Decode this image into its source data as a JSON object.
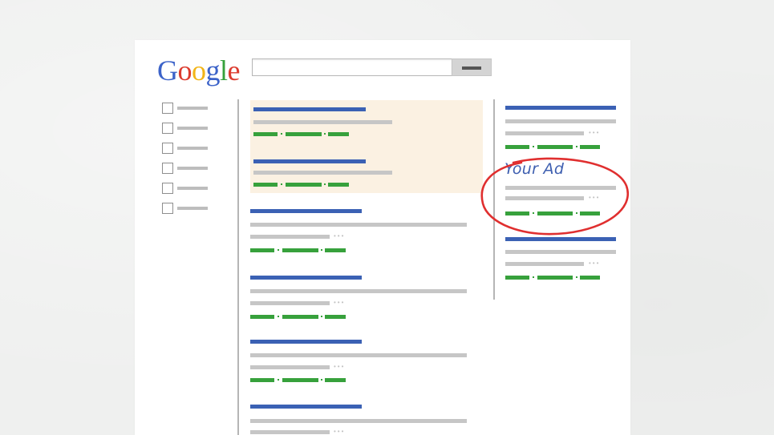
{
  "logo": {
    "letters": [
      {
        "char": "G",
        "color": "#3c63c9"
      },
      {
        "char": "o",
        "color": "#dc3b2e"
      },
      {
        "char": "o",
        "color": "#f2b518"
      },
      {
        "char": "g",
        "color": "#3c63c9"
      },
      {
        "char": "l",
        "color": "#37a13c"
      },
      {
        "char": "e",
        "color": "#dc3b2e"
      }
    ]
  },
  "search": {
    "value": "",
    "button_icon": "search-button-bar-icon"
  },
  "filters": {
    "count": 6
  },
  "annotation": {
    "label": "Your Ad",
    "circle_color": "#e02f2f"
  },
  "colors": {
    "result_title": "#3b61b4",
    "snippet": "#c6c6c6",
    "url": "#37a13c",
    "ad_background": "#fbf1e2"
  }
}
